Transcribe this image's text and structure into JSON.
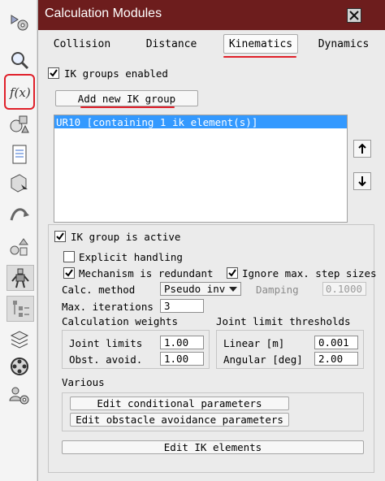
{
  "toolbar": {
    "items": [
      {
        "name": "simulation-settings-icon"
      },
      {
        "name": "magnifier-icon"
      },
      {
        "name": "calculation-modules-icon",
        "label": "f(x)"
      },
      {
        "name": "shapes-icon"
      },
      {
        "name": "document-icon"
      },
      {
        "name": "cube-select-icon"
      },
      {
        "name": "path-icon"
      },
      {
        "name": "model-browser-icon"
      },
      {
        "name": "robot-icon"
      },
      {
        "name": "scene-hierarchy-icon"
      },
      {
        "name": "layers-icon"
      },
      {
        "name": "video-recorder-icon"
      },
      {
        "name": "user-settings-icon"
      }
    ]
  },
  "window": {
    "title": "Calculation Modules",
    "close_label": "close",
    "accent_color": "#6d1d1d"
  },
  "tabs": [
    {
      "label": "Collision"
    },
    {
      "label": "Distance"
    },
    {
      "label": "Kinematics",
      "active": true
    },
    {
      "label": "Dynamics"
    }
  ],
  "ik": {
    "groups_enabled_label": "IK groups enabled",
    "groups_enabled": true,
    "add_group_label": "Add new IK group",
    "group_list": [
      "UR10 [containing 1 ik element(s)]"
    ],
    "selected_color": "#3399ff"
  },
  "group": {
    "active_label": "IK group is active",
    "active": true,
    "explicit_handling_label": "Explicit handling",
    "explicit_handling": false,
    "redundant_label": "Mechanism is redundant",
    "redundant": true,
    "ignore_step_label": "Ignore max. step sizes",
    "ignore_step": true,
    "calc_method_label": "Calc. method",
    "calc_method_value": "Pseudo inv",
    "damping_label": "Damping",
    "damping_value": "0.1000",
    "max_iter_label": "Max. iterations",
    "max_iter_value": "3",
    "weights_title": "Calculation weights",
    "joint_limits_label": "Joint limits",
    "joint_limits_value": "1.00",
    "obstacle_avoid_label": "Obst. avoid.",
    "obstacle_avoid_value": "1.00",
    "thresholds_title": "Joint limit thresholds",
    "linear_label": "Linear [m]",
    "linear_value": "0.001",
    "angular_label": "Angular [deg]",
    "angular_value": "2.00",
    "various_title": "Various",
    "edit_conditional_label": "Edit conditional parameters",
    "edit_obstacle_label": "Edit obstacle avoidance parameters",
    "edit_ik_elements_label": "Edit IK elements"
  },
  "annotation_color": "#e0202a"
}
